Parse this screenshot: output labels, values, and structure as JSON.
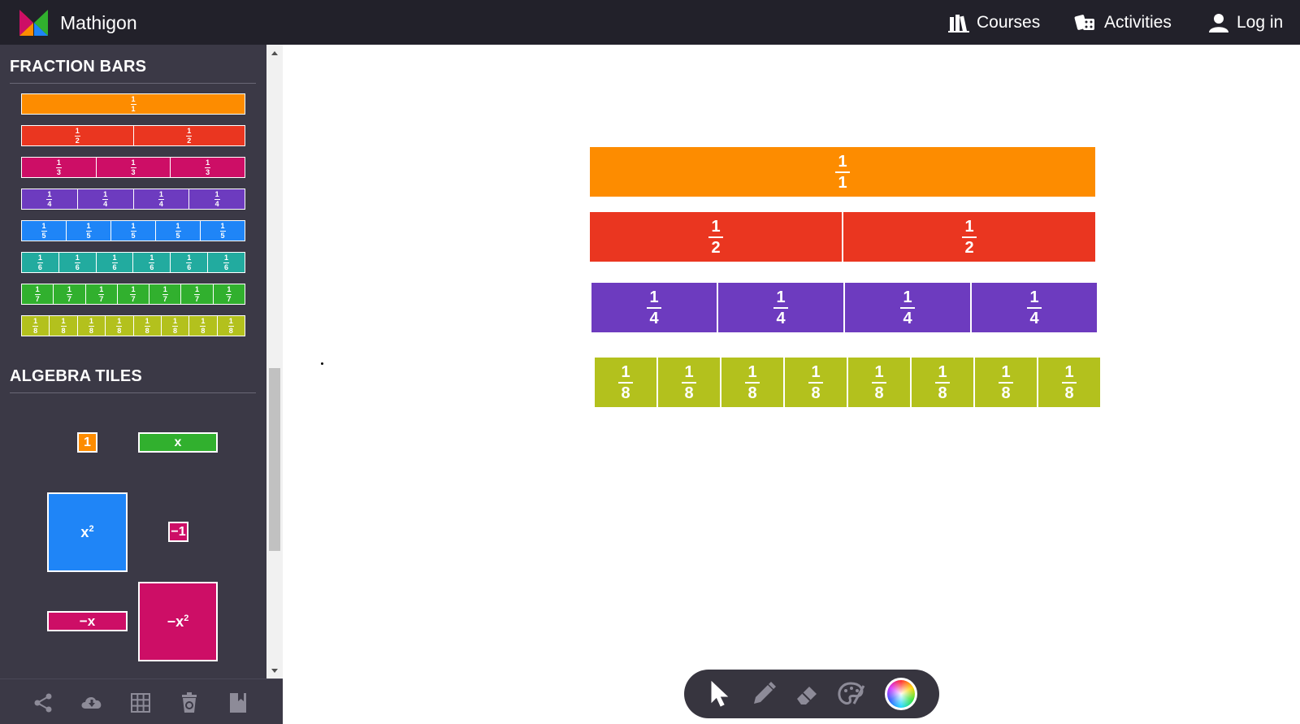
{
  "header": {
    "brand": "Mathigon",
    "nav": {
      "courses": "Courses",
      "activities": "Activities",
      "login": "Log in"
    }
  },
  "sidebar": {
    "fraction_bars_title": "FRACTION BARS",
    "algebra_tiles_title": "ALGEBRA TILES",
    "fraction_bars": [
      {
        "denominator": 1,
        "color": "#fd8c00"
      },
      {
        "denominator": 2,
        "color": "#ea3620"
      },
      {
        "denominator": 3,
        "color": "#cd0e66"
      },
      {
        "denominator": 4,
        "color": "#6d3bbf"
      },
      {
        "denominator": 5,
        "color": "#1f85f7"
      },
      {
        "denominator": 6,
        "color": "#22ab9f"
      },
      {
        "denominator": 7,
        "color": "#31b02e"
      },
      {
        "denominator": 8,
        "color": "#b3c11d"
      }
    ],
    "algebra_tiles": {
      "one": {
        "label": "1",
        "color": "#fd8c00"
      },
      "x": {
        "label": "x",
        "color": "#31b02e"
      },
      "x_squared": {
        "label": "x",
        "sup": "2",
        "color": "#1f85f7"
      },
      "neg_one": {
        "label": "−1",
        "color": "#cd0e66"
      },
      "neg_x": {
        "label": "−x",
        "color": "#cd0e66"
      },
      "neg_x_squared": {
        "label": "−x",
        "sup": "2",
        "color": "#cd0e66"
      }
    },
    "footer_icons": [
      "share-icon",
      "cloud-download-icon",
      "grid-icon",
      "clear-icon",
      "bookmark-icon"
    ]
  },
  "canvas": {
    "bars": [
      {
        "denominator": 1,
        "color": "#fd8c00"
      },
      {
        "denominator": 2,
        "color": "#ea3620"
      },
      {
        "denominator": 4,
        "color": "#6d3bbf"
      },
      {
        "denominator": 8,
        "color": "#b3c11d"
      }
    ]
  },
  "toolbar": {
    "tools": [
      "pointer-icon",
      "pen-icon",
      "eraser-icon",
      "palette-icon",
      "color-wheel"
    ]
  }
}
